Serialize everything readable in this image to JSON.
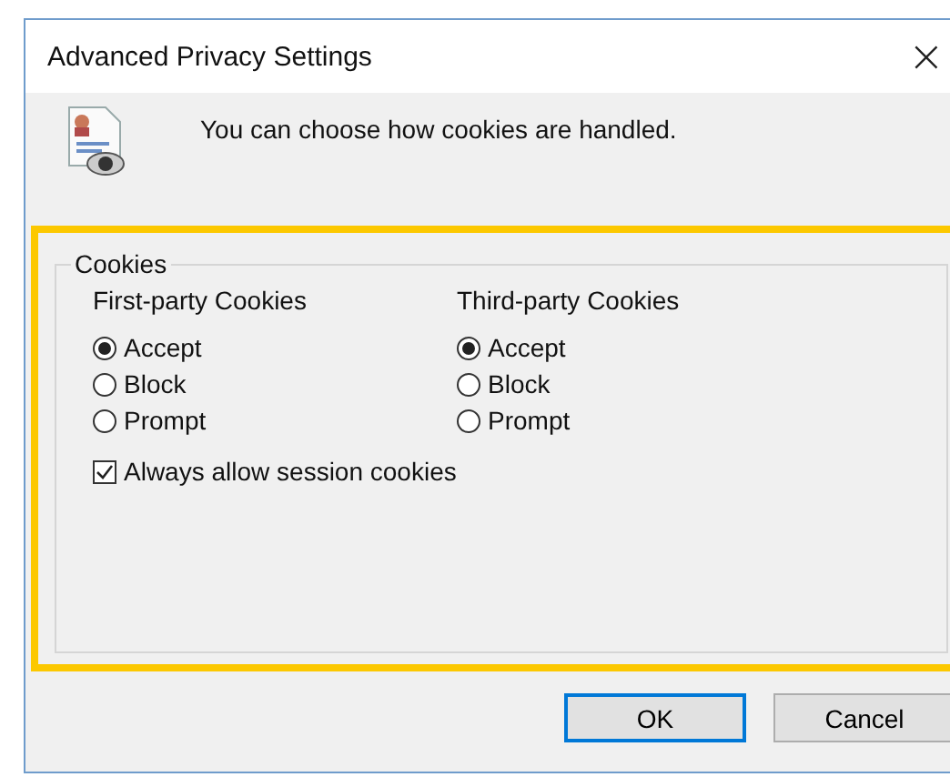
{
  "window": {
    "title": "Advanced Privacy Settings",
    "close": "×"
  },
  "header": {
    "message": "You can choose how cookies are handled."
  },
  "cookies": {
    "title": "Cookies",
    "highlighted": true,
    "columns": [
      {
        "heading": "First-party Cookies",
        "options": [
          {
            "label": "Accept",
            "selected": true
          },
          {
            "label": "Block",
            "selected": false
          },
          {
            "label": "Prompt",
            "selected": false
          }
        ]
      },
      {
        "heading": "Third-party Cookies",
        "options": [
          {
            "label": "Accept",
            "selected": true
          },
          {
            "label": "Block",
            "selected": false
          },
          {
            "label": "Prompt",
            "selected": false
          }
        ]
      }
    ],
    "session": {
      "label": "Always allow session cookies",
      "checked": true
    }
  },
  "buttons": [
    {
      "label": "OK",
      "default": true
    },
    {
      "label": "Cancel",
      "default": false
    }
  ]
}
